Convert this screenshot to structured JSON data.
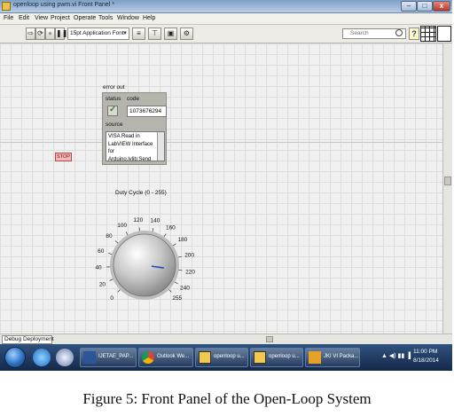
{
  "window": {
    "title": "openloop using pwm.vi Front Panel *",
    "controls": {
      "minimize": "–",
      "maximize": "□",
      "close": "x"
    }
  },
  "menu": [
    "File",
    "Edit",
    "View",
    "Project",
    "Operate",
    "Tools",
    "Window",
    "Help"
  ],
  "toolbar": {
    "font": "15pt Application Font",
    "search_placeholder": "Search",
    "help": "?"
  },
  "error_out": {
    "label": "error out",
    "status_label": "status",
    "code_label": "code",
    "status_glyph": "✓",
    "code_value": "1073676294",
    "source_label": "source",
    "source_value": "VISA Read in LabVIEW Interface for Arduino.lvlib:Send"
  },
  "stop": {
    "label": "STOP"
  },
  "dial": {
    "label": "Duty Cycle (0 - 255)",
    "min": 0,
    "max": 255,
    "value": 220,
    "ticks": [
      "0",
      "20",
      "40",
      "60",
      "80",
      "100",
      "120",
      "140",
      "160",
      "180",
      "200",
      "220",
      "240",
      "255"
    ]
  },
  "statusbar": {
    "project": "Debug Deployment"
  },
  "taskbar": {
    "tasks": [
      {
        "label": "IJETAE_PAP...",
        "icon": "word-icon"
      },
      {
        "label": "Outlook We...",
        "icon": "chrome-icon"
      },
      {
        "label": "openloop u...",
        "icon": "labview-vi-icon"
      },
      {
        "label": "openloop u...",
        "icon": "labview-vi-icon"
      },
      {
        "label": "JKI VI Packa...",
        "icon": "vipm-icon"
      }
    ],
    "tray": "▲ ◀) ▮▮ ▐",
    "time": "11:00 PM",
    "date": "8/18/2014"
  },
  "caption": "Figure 5: Front Panel of the Open-Loop System"
}
